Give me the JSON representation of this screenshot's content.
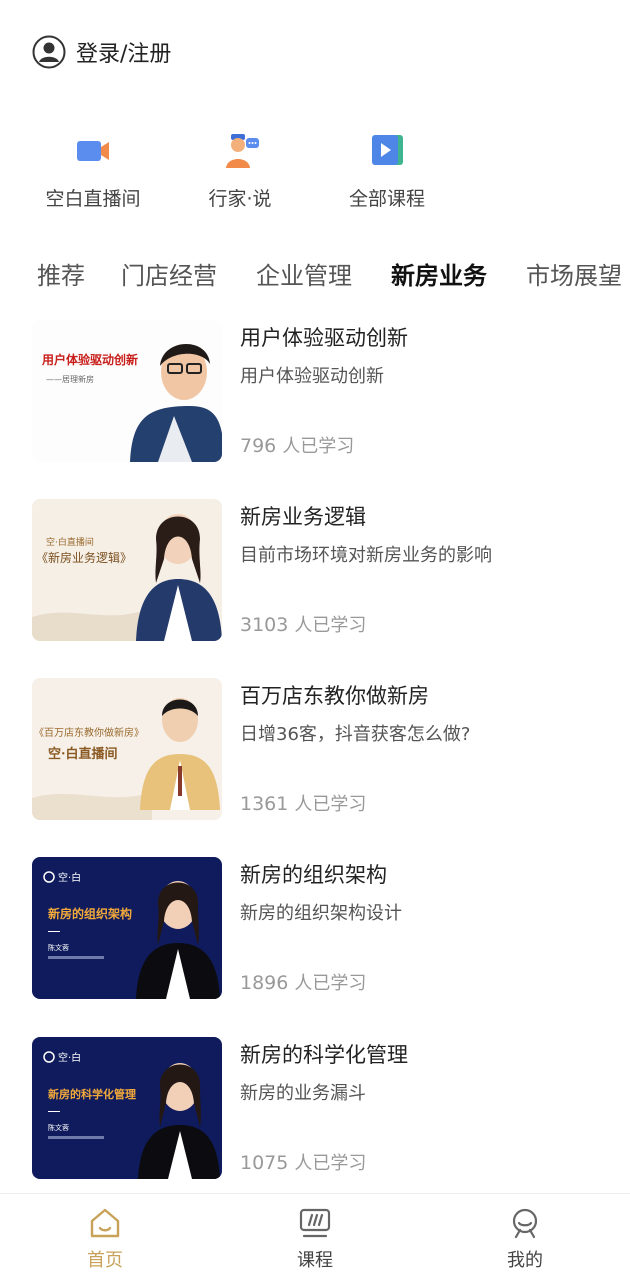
{
  "header": {
    "login_label": "登录/注册"
  },
  "quick_links": [
    {
      "label": "空白直播间",
      "icon": "video-camera-icon"
    },
    {
      "label": "行家·说",
      "icon": "expert-speaker-icon"
    },
    {
      "label": "全部课程",
      "icon": "course-play-icon"
    }
  ],
  "tabs": [
    {
      "label": "推荐",
      "active": false
    },
    {
      "label": "门店经营",
      "active": false
    },
    {
      "label": "企业管理",
      "active": false
    },
    {
      "label": "新房业务",
      "active": true
    },
    {
      "label": "市场展望",
      "active": false
    }
  ],
  "courses": [
    {
      "title": "用户体验驱动创新",
      "subtitle": "用户体验驱动创新",
      "count": "796",
      "unit": "人已学习",
      "thumb_text": [
        "用户体验驱动创新",
        "——居理新房"
      ]
    },
    {
      "title": "新房业务逻辑",
      "subtitle": "目前市场环境对新房业务的影响",
      "count": "3103",
      "unit": "人已学习",
      "thumb_text": [
        "空·白直播间",
        "《新房业务逻辑》"
      ]
    },
    {
      "title": "百万店东教你做新房",
      "subtitle": "日增36客，抖音获客怎么做?",
      "count": "1361",
      "unit": "人已学习",
      "thumb_text": [
        "《百万店东教你做新房》",
        "空·白直播间"
      ]
    },
    {
      "title": "新房的组织架构",
      "subtitle": "新房的组织架构设计",
      "count": "1896",
      "unit": "人已学习",
      "thumb_text": [
        "空·白",
        "新房的组织架构",
        "陈文蓉"
      ]
    },
    {
      "title": "新房的科学化管理",
      "subtitle": "新房的业务漏斗",
      "count": "1075",
      "unit": "人已学习",
      "thumb_text": [
        "空·白",
        "新房的科学化管理",
        "陈文蓉"
      ]
    }
  ],
  "bottom_nav": [
    {
      "label": "首页",
      "icon": "home-icon",
      "active": true
    },
    {
      "label": "课程",
      "icon": "course-screen-icon",
      "active": false
    },
    {
      "label": "我的",
      "icon": "profile-icon",
      "active": false
    }
  ],
  "colors": {
    "accent": "#c9a25a",
    "thumb_navy": "#0f1b5c",
    "text_muted": "#999999"
  }
}
